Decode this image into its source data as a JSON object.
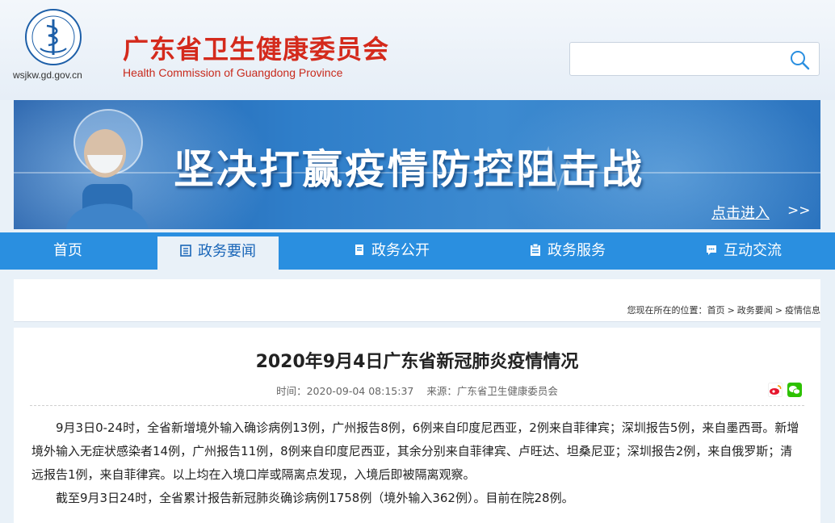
{
  "site": {
    "domain": "wsjkw.gd.gov.cn",
    "title_cn": "广东省卫生健康委员会",
    "title_en": "Health Commission of Guangdong Province",
    "search_placeholder": ""
  },
  "banner": {
    "slogan": "坚决打赢疫情防控阻击战",
    "enter_label": "点击进入",
    "arrow": ">>"
  },
  "nav": {
    "items": [
      {
        "label": "首页",
        "icon": ""
      },
      {
        "label": "政务要闻",
        "icon": "news-icon",
        "active": true
      },
      {
        "label": "政务公开",
        "icon": "document-icon"
      },
      {
        "label": "政务服务",
        "icon": "clipboard-icon"
      },
      {
        "label": "互动交流",
        "icon": "chat-icon"
      }
    ]
  },
  "breadcrumb": {
    "prefix": "您现在所在的位置：",
    "items": [
      "首页",
      "政务要闻",
      "疫情信息"
    ],
    "separator": ">"
  },
  "article": {
    "title": "2020年9月4日广东省新冠肺炎疫情情况",
    "time": "时间：2020-09-04 08:15:37",
    "source": "来源：广东省卫生健康委员会",
    "paragraphs": [
      "9月3日0-24时，全省新增境外输入确诊病例13例，广州报告8例，6例来自印度尼西亚，2例来自菲律宾；深圳报告5例，来自墨西哥。新增境外输入无症状感染者14例，广州报告11例，8例来自印度尼西亚，其余分别来自菲律宾、卢旺达、坦桑尼亚；深圳报告2例，来自俄罗斯；清远报告1例，来自菲律宾。以上均在入境口岸或隔离点发现，入境后即被隔离观察。",
      "截至9月3日24时，全省累计报告新冠肺炎确诊病例1758例（境外输入362例）。目前在院28例。"
    ],
    "share_icons": [
      "weibo-icon",
      "wechat-icon"
    ]
  },
  "colors": {
    "brand_red": "#d42a1c",
    "nav_blue": "#2a8fe0",
    "active_text": "#1a66b8"
  }
}
